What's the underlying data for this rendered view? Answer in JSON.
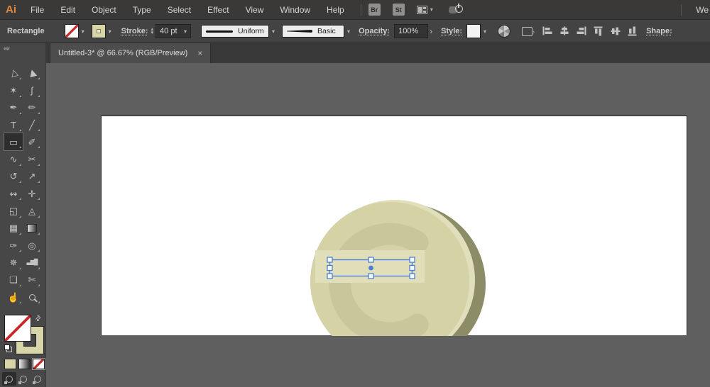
{
  "menubar": {
    "logo_text": "Ai",
    "items": [
      "File",
      "Edit",
      "Object",
      "Type",
      "Select",
      "Effect",
      "View",
      "Window",
      "Help"
    ],
    "bridge_badge": "Br",
    "stock_badge": "St",
    "workspace_label": "We"
  },
  "controlbar": {
    "selected_object_label": "Rectangle",
    "stroke_label": "Stroke:",
    "stroke_weight_value": "40 pt",
    "variable_width_value": "Uniform",
    "brush_value": "Basic",
    "opacity_label": "Opacity:",
    "opacity_value": "100%",
    "opacity_flyout_glyph": "›",
    "style_label": "Style:",
    "shape_label": "Shape:",
    "align_icons": [
      "align-left-icon",
      "align-h-center-icon",
      "align-right-icon",
      "align-top-icon",
      "align-v-center-icon",
      "align-bottom-icon"
    ]
  },
  "document_tab": {
    "title": "Untitled-3* @ 66.67% (RGB/Preview)",
    "close_glyph": "×"
  },
  "toolbar": {
    "collapse_glyph": "««",
    "tools": [
      {
        "name": "selection-tool",
        "glyph": "▷",
        "rot": -105
      },
      {
        "name": "direct-selection-tool",
        "glyph": "▶",
        "rot": -105
      },
      {
        "name": "magic-wand-tool",
        "glyph": "✶"
      },
      {
        "name": "lasso-tool",
        "glyph": "ʃ"
      },
      {
        "name": "pen-tool",
        "glyph": "✒"
      },
      {
        "name": "curvature-tool",
        "glyph": "✏"
      },
      {
        "name": "type-tool",
        "glyph": "T"
      },
      {
        "name": "line-segment-tool",
        "glyph": "╱"
      },
      {
        "name": "rectangle-tool",
        "glyph": "▭",
        "selected": true
      },
      {
        "name": "paintbrush-tool",
        "glyph": "✐"
      },
      {
        "name": "shaper-tool",
        "glyph": "∿"
      },
      {
        "name": "scissors-tool",
        "glyph": "✂"
      },
      {
        "name": "rotate-tool",
        "glyph": "↺"
      },
      {
        "name": "scale-tool",
        "glyph": "↗"
      },
      {
        "name": "width-tool",
        "glyph": "↭"
      },
      {
        "name": "puppet-warp-tool",
        "glyph": "✛"
      },
      {
        "name": "shape-builder-tool",
        "glyph": "◱"
      },
      {
        "name": "perspective-grid-tool",
        "glyph": "◬"
      },
      {
        "name": "mesh-tool",
        "glyph": "▦"
      },
      {
        "name": "gradient-tool",
        "kind": "gradient"
      },
      {
        "name": "eyedropper-tool",
        "glyph": "✑"
      },
      {
        "name": "blend-tool",
        "glyph": "◎"
      },
      {
        "name": "symbol-sprayer-tool",
        "glyph": "✵"
      },
      {
        "name": "column-graph-tool",
        "glyph": "▃▆█",
        "kind": "bars"
      },
      {
        "name": "artboard-tool",
        "glyph": "❏"
      },
      {
        "name": "slice-tool",
        "glyph": "✄"
      },
      {
        "name": "hand-tool",
        "glyph": "☝"
      },
      {
        "name": "zoom-tool",
        "kind": "magnifier"
      }
    ]
  },
  "ui_glyphs": {
    "chevron": "▾",
    "spinner_up": "▴",
    "spinner_down": "▾",
    "swap": "⇄",
    "isolate_arrow": "›"
  },
  "colors": {
    "accent_blue": "#4a7fd8",
    "coin_face": "#d5d2a5",
    "coin_rim": "#e0debb",
    "coin_side": "#8c8c67",
    "coin_symbol": "#c9c69b",
    "coin_bar": "#e1dfba",
    "stroke_swatch": "#d8d5a8"
  }
}
